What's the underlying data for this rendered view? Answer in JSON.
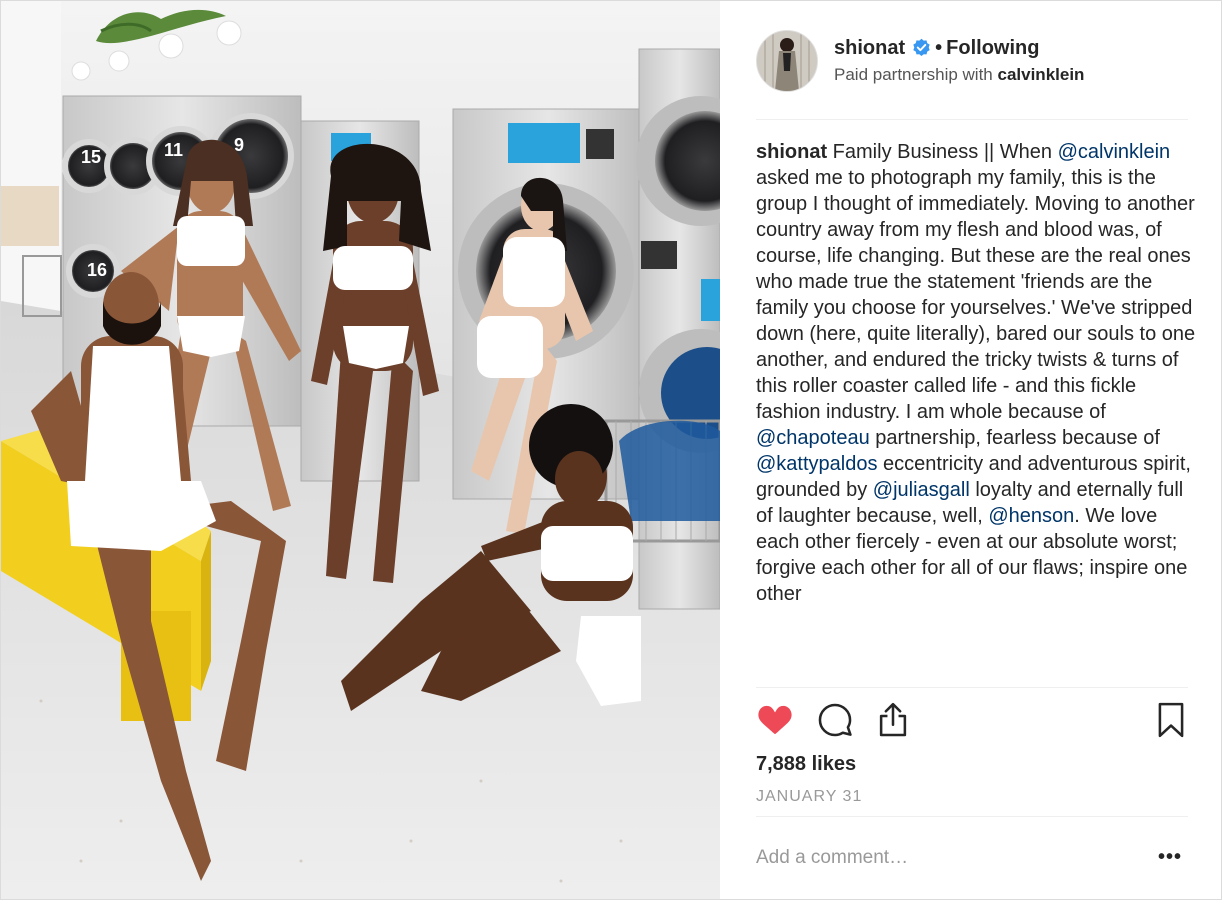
{
  "post": {
    "username": "shionat",
    "verified": true,
    "follow_separator": "•",
    "follow_status": "Following",
    "partnership_prefix": "Paid partnership with",
    "partner": "calvinklein",
    "photo_icon": "photograph",
    "avatar_icon": "profile-photo"
  },
  "caption": {
    "username": "shionat",
    "segments": [
      {
        "text": " Family Business || When "
      },
      {
        "text": "@calvinklein",
        "mention": true
      },
      {
        "text": " asked me to photograph my family, this is the group I thought of immediately. Moving to another country away from my flesh and blood was, of course, life changing. But these are the real ones who made true the statement 'friends are the family you choose for yourselves.' We've stripped down (here, quite literally), bared our souls to one another, and endured the tricky twists & turns of this roller coaster called life - and this fickle fashion industry. I am whole because of "
      },
      {
        "text": "@chapoteau",
        "mention": true
      },
      {
        "text": " partnership, fearless because of "
      },
      {
        "text": "@kattypaldos",
        "mention": true
      },
      {
        "text": " eccentricity and adventurous spirit, grounded by "
      },
      {
        "text": "@juliasgall",
        "mention": true
      },
      {
        "text": " loyalty and eternally full of laughter because, well, "
      },
      {
        "text": "@henson",
        "mention": true
      },
      {
        "text": ". We love each other fiercely - even at our absolute worst; forgive each other for all of our flaws; inspire one other"
      }
    ]
  },
  "actions": {
    "like_icon": "heart-filled-icon",
    "comment_icon": "comment-icon",
    "share_icon": "share-icon",
    "save_icon": "bookmark-icon",
    "liked": true
  },
  "likes_text": "7,888 likes",
  "date": "JANUARY 31",
  "comment": {
    "placeholder": "Add a comment…",
    "value": "",
    "more_label": "•••"
  },
  "colors": {
    "like": "#ed4956",
    "mention": "#003569",
    "verified": "#3897f0",
    "muted": "#999999",
    "divider": "#efefef"
  }
}
